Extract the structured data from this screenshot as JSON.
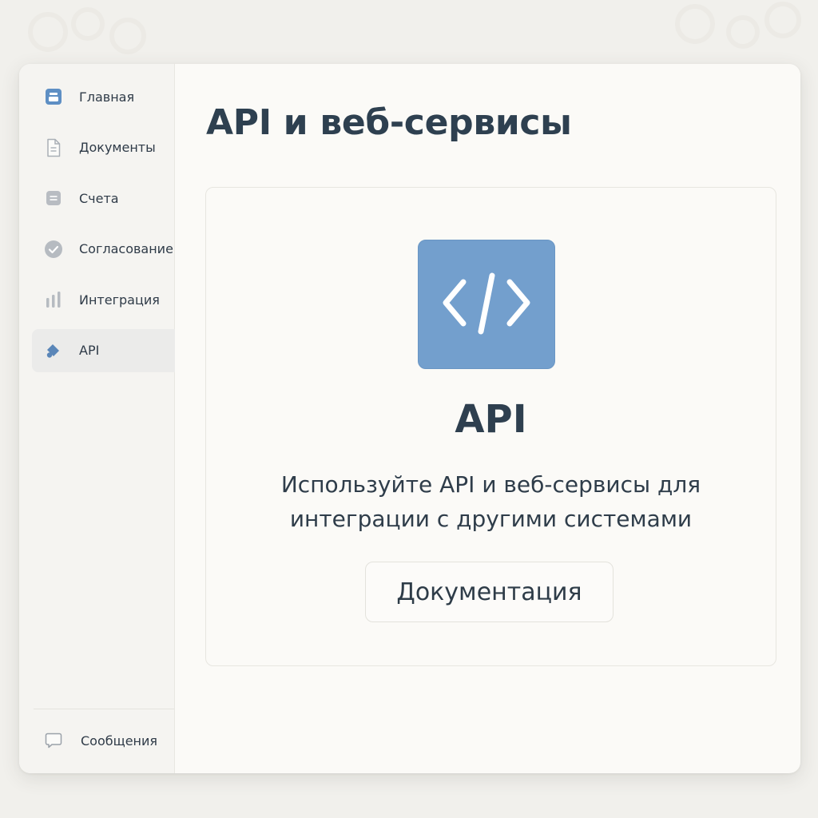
{
  "sidebar": {
    "items": [
      {
        "label": "Главная",
        "icon": "home-icon",
        "active": false
      },
      {
        "label": "Документы",
        "icon": "document-icon",
        "active": false
      },
      {
        "label": "Счета",
        "icon": "invoice-icon",
        "active": false
      },
      {
        "label": "Согласование",
        "icon": "check-circle-icon",
        "active": false
      },
      {
        "label": "Интеграция",
        "icon": "bar-chart-icon",
        "active": false
      },
      {
        "label": "API",
        "icon": "api-icon",
        "active": true
      }
    ],
    "bottom": {
      "label": "Сообщения",
      "icon": "message-icon"
    }
  },
  "main": {
    "title": "API и веб-сервисы",
    "card": {
      "icon": "code-icon",
      "title": "API",
      "description_line1": "Используйте API и веб-сервисы для",
      "description_line2": "интеграции с другими системами",
      "button_label": "Документация"
    }
  },
  "colors": {
    "accent": "#739fcd",
    "sidebar_bg": "#f5f4f1",
    "active_item_bg": "#ebebea",
    "text": "#2e3e4c",
    "page_bg": "#f1f0ec"
  }
}
